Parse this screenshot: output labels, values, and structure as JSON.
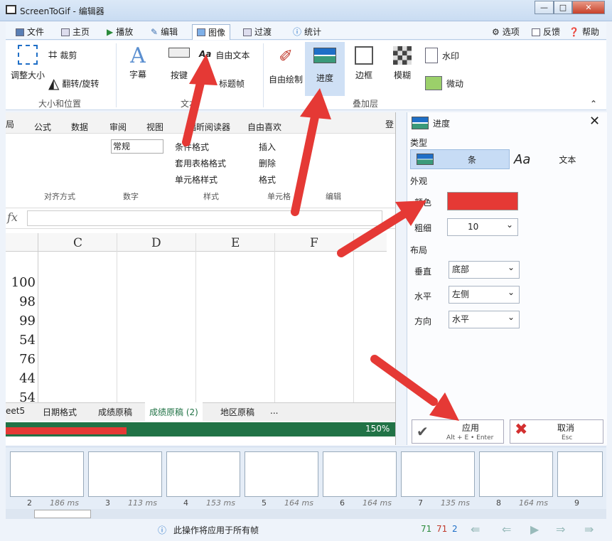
{
  "window": {
    "title": "ScreenToGif - 编辑器",
    "min": "—",
    "max": "□",
    "close": "✕"
  },
  "menu": {
    "file": "文件",
    "home": "主页",
    "play": "播放",
    "edit": "编辑",
    "image": "图像",
    "transition": "过渡",
    "stats": "统计",
    "options": "选项",
    "feedback": "反馈",
    "help": "帮助"
  },
  "ribbon": {
    "resize": "调整大小",
    "crop": "裁剪",
    "flip": "翻转/旋转",
    "group_size": "大小和位置",
    "caption": "字幕",
    "keystrokes": "按键",
    "freetext": "自由文本",
    "titleframe": "标题帧",
    "group_text": "文本",
    "freedraw": "自由绘制",
    "progress": "进度",
    "border": "边框",
    "blur": "模糊",
    "watermark": "水印",
    "cinemagraph": "微动",
    "group_overlay": "叠加层"
  },
  "excel": {
    "tabs": [
      "局",
      "公式",
      "数据",
      "审阅",
      "视图",
      "福昕阅读器",
      "自由喜欢",
      "登"
    ],
    "numfmt": "常规",
    "condfmt": "条件格式",
    "tablefmt": "套用表格格式",
    "cellstyle": "单元格样式",
    "insert": "插入",
    "delete": "删除",
    "format": "格式",
    "grp_align": "对齐方式",
    "grp_num": "数字",
    "grp_style": "样式",
    "grp_cell": "单元格",
    "grp_edit": "编辑",
    "fx": "fx",
    "cols": [
      "C",
      "D",
      "E",
      "F"
    ],
    "rows": [
      "100",
      "98",
      "99",
      "54",
      "76",
      "44",
      "54"
    ],
    "sheets": [
      "eet5",
      "日期格式",
      "成绩原稿",
      "成绩原稿 (2)",
      "地区原稿",
      "..."
    ],
    "zoom": "150%"
  },
  "panel": {
    "title": "进度",
    "type": "类型",
    "bar": "条",
    "text": "文本",
    "look": "外观",
    "color_label": "颜色",
    "color": "#e53935",
    "thickness_label": "粗细",
    "thickness": "10",
    "layout": "布局",
    "vertical_label": "垂直",
    "vertical": "底部",
    "horizontal_label": "水平",
    "horizontal": "左侧",
    "direction_label": "方向",
    "direction": "水平",
    "apply": "应用",
    "apply_hint": "Alt + E • Enter",
    "cancel": "取消",
    "cancel_hint": "Esc"
  },
  "frames": [
    {
      "n": "2",
      "ms": "186 ms"
    },
    {
      "n": "3",
      "ms": "113 ms"
    },
    {
      "n": "4",
      "ms": "153 ms"
    },
    {
      "n": "5",
      "ms": "164 ms"
    },
    {
      "n": "6",
      "ms": "164 ms"
    },
    {
      "n": "7",
      "ms": "135 ms"
    },
    {
      "n": "8",
      "ms": "164 ms"
    },
    {
      "n": "9",
      "ms": ""
    }
  ],
  "status": {
    "msg": "此操作将应用于所有帧",
    "count_total": "71",
    "count_sel": "71",
    "count_cur": "2"
  },
  "colors": {
    "accent": "#1f6fc7",
    "excel_green": "#217346",
    "red": "#e53935"
  }
}
